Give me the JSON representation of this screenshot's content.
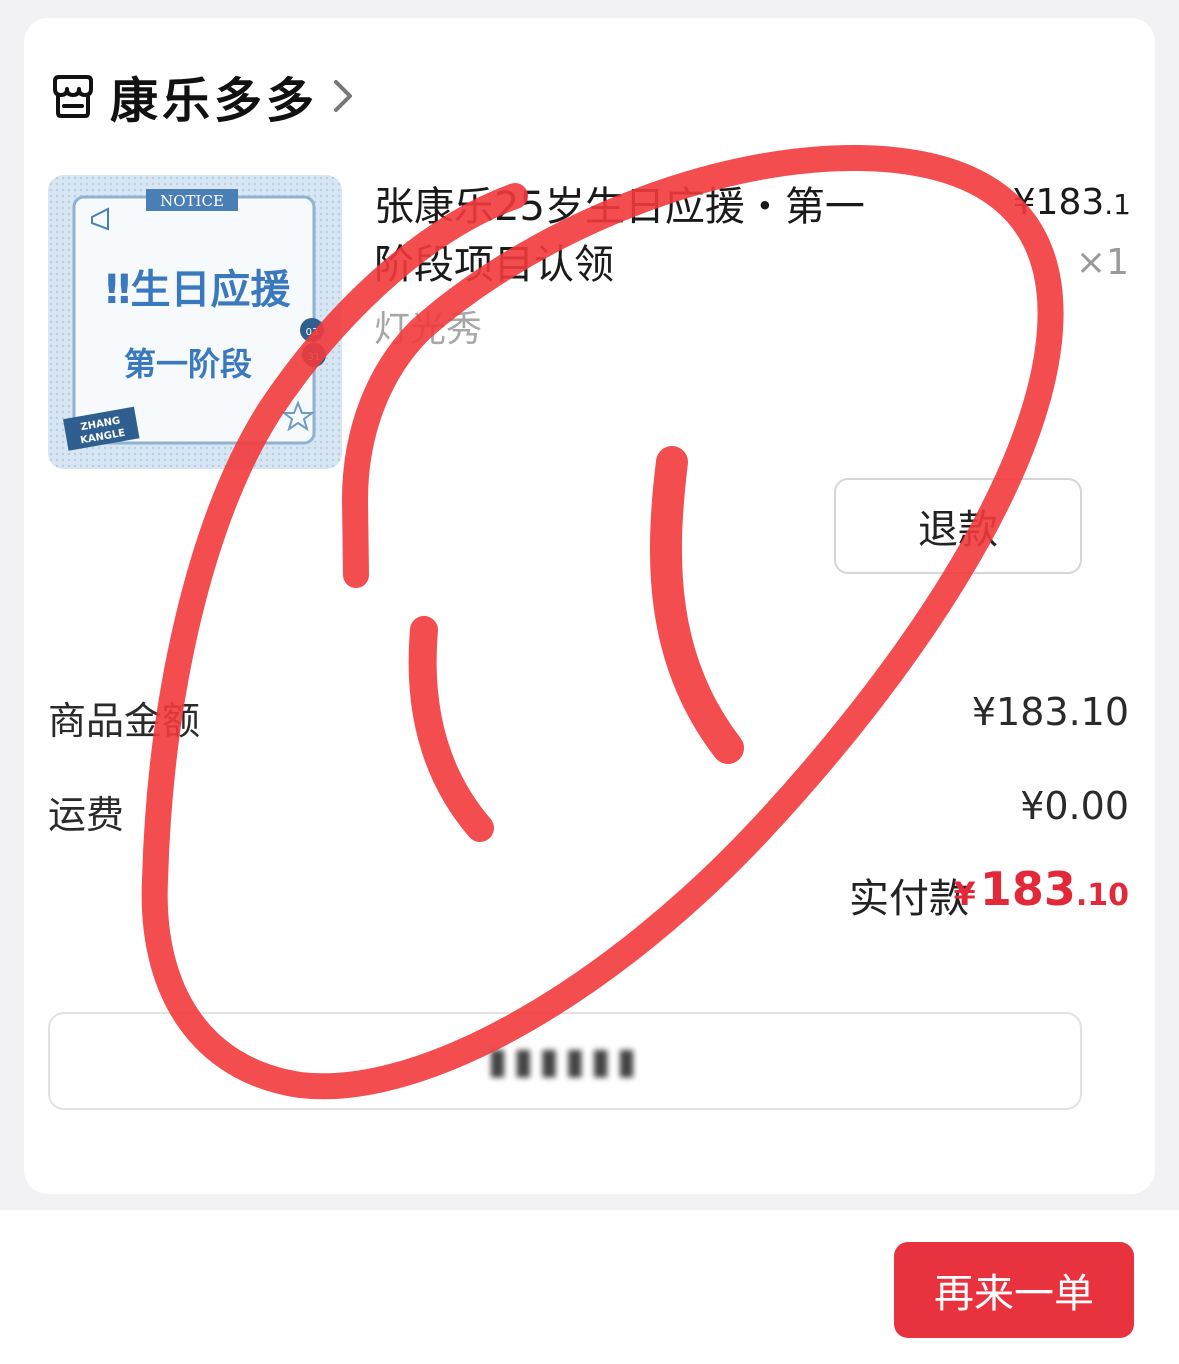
{
  "shop": {
    "name": "康乐多多",
    "icon": "store-icon"
  },
  "product": {
    "title": "张康乐25岁生日应援・第一阶段项目认领",
    "variant": "灯光秀",
    "price_main": "¥183",
    "price_small": ".1",
    "quantity": "×1",
    "image": {
      "notice": "NOTICE",
      "line1": "‼生日应援",
      "line2": "第一阶段",
      "date_top": "03",
      "date_bottom": "31",
      "tag_line1": "ZHANG",
      "tag_line2": "KANGLE"
    }
  },
  "actions": {
    "refund": "退款",
    "reorder": "再来一单",
    "blurred_button": "▮▮▮▮▮▮"
  },
  "summary": {
    "goods_label": "商品金额",
    "goods_value": "¥183.10",
    "shipping_label": "运费",
    "shipping_value": "¥0.00",
    "paid_label": "实付款",
    "paid_symbol": "¥",
    "paid_int": "183",
    "paid_dec": ".10"
  },
  "colors": {
    "accent": "#e8323e",
    "paid": "#e3283a",
    "scribble": "#f23a3c"
  }
}
